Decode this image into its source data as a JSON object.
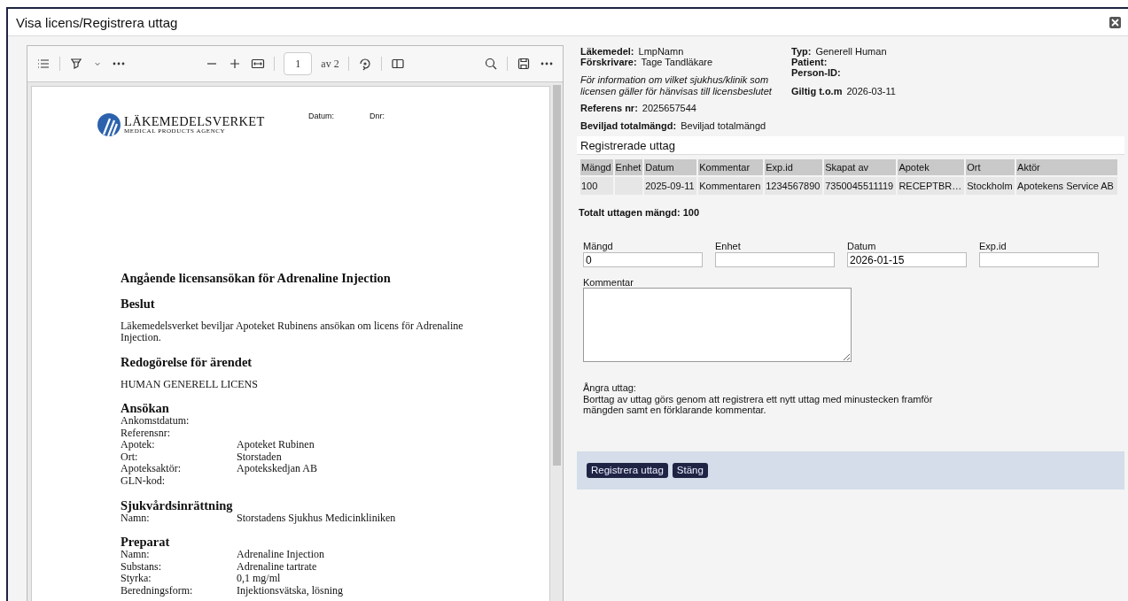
{
  "window": {
    "title": "Visa licens/Registrera uttag"
  },
  "pdf_viewer": {
    "page_input": "1",
    "page_count": "av 2",
    "document": {
      "logo": {
        "name": "LÄKEMEDELSVERKET",
        "subtitle": "MEDICAL PRODUCTS AGENCY"
      },
      "header_fields": [
        "Datum:",
        "Dnr:"
      ],
      "title": "Angående licensansökan för Adrenaline Injection",
      "blocks": [
        {
          "kind": "heading",
          "text": "Beslut"
        },
        {
          "kind": "paragraph",
          "text": "Läkemedelsverket beviljar Apoteket Rubinens ansökan om licens för Adrenaline Injection."
        },
        {
          "kind": "heading",
          "text": "Redogörelse för ärendet"
        },
        {
          "kind": "paragraph",
          "text": "HUMAN GENERELL LICENS"
        },
        {
          "kind": "section",
          "text": "Ansökan",
          "rows": [
            {
              "label": "Ankomstdatum:"
            },
            {
              "label": "Referensnr:"
            },
            {
              "label": "Apotek:",
              "value": "Apoteket Rubinen"
            },
            {
              "label": "Ort:",
              "value": "Storstaden"
            },
            {
              "label": "Apoteksaktör:",
              "value": "Apotekskedjan AB"
            },
            {
              "label": "GLN-kod:"
            }
          ]
        },
        {
          "kind": "section",
          "text": "Sjukvårdsinrättning",
          "rows": [
            {
              "label": "Namn:",
              "value": "Storstadens Sjukhus Medicinkliniken"
            }
          ]
        },
        {
          "kind": "section",
          "text": "Preparat",
          "rows": [
            {
              "label": "Namn:",
              "value": "Adrenaline Injection"
            },
            {
              "label": "Substans:",
              "value": "Adrenaline tartrate"
            },
            {
              "label": "Styrka:",
              "value": "0,1 mg/ml"
            },
            {
              "label": "Beredningsform:",
              "value": "Injektionsvätska, lösning"
            }
          ]
        }
      ]
    }
  },
  "license": {
    "left": [
      {
        "label": "Läkemedel:",
        "value": "LmpNamn"
      },
      {
        "label": "Förskrivare:",
        "value": "Tage Tandläkare"
      }
    ],
    "note": "För information om vilket sjukhus/klinik som licensen gäller för hänvisas till licensbeslutet",
    "reference": {
      "label": "Referens nr:",
      "value": "2025657544"
    },
    "approved_total": {
      "label": "Beviljad totalmängd:",
      "value": "Beviljad totalmängd"
    },
    "right": [
      {
        "label": "Typ:",
        "value": "Generell Human"
      },
      {
        "label": "Patient:"
      },
      {
        "label": "Person-ID:"
      }
    ],
    "valid_until": {
      "label": "Giltig t.o.m",
      "value": "2026-03-11"
    }
  },
  "registered": {
    "title": "Registrerade uttag",
    "table": {
      "columns": [
        "Mängd",
        "Enhet",
        "Datum",
        "Kommentar",
        "Exp.id",
        "Skapat av",
        "Apotek",
        "Ort",
        "Aktör"
      ],
      "rows": [
        [
          "100",
          "",
          "2025-09-11",
          "Kommentaren",
          "1234567890",
          "7350045511119",
          "RECEPTBR…",
          "Stockholm",
          "Apotekens Service AB"
        ]
      ]
    },
    "total": "Totalt uttagen mängd: 100"
  },
  "form": {
    "fields": [
      {
        "label": "Mängd",
        "value": "0"
      },
      {
        "label": "Enhet"
      },
      {
        "label": "Datum",
        "value": "2026-01-15"
      },
      {
        "label": "Exp.id"
      }
    ],
    "comment_label": "Kommentar",
    "undo_title": "Ångra uttag:",
    "undo_text": "Borttag av uttag görs genom att registrera ett nytt uttag med minustecken framför mängden samt en förklarande kommentar."
  },
  "buttons": [
    "Registrera uttag",
    "Stäng"
  ]
}
